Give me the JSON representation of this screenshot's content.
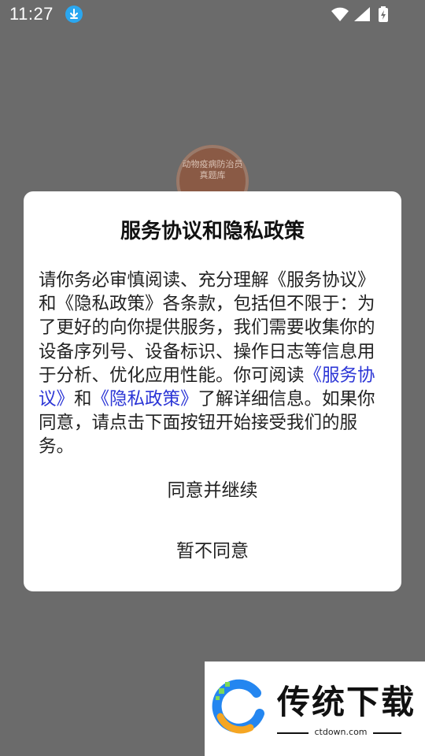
{
  "status_bar": {
    "time": "11:27",
    "icons": [
      "download-icon",
      "wifi-icon",
      "signal-icon",
      "battery-charging-icon"
    ]
  },
  "app": {
    "icon_label_line1": "动物疫病防治员",
    "icon_label_line2": "真题库"
  },
  "dialog": {
    "title": "服务协议和隐私政策",
    "body_part1": "请你务必审慎阅读、充分理解《服务协议》和《隐私政策》各条款，包括但不限于：为了更好的向你提供服务，我们需要收集你的设备序列号、设备标识、操作日志等信息用于分析、优化应用性能。你可阅读",
    "link_service": "《服务协议》",
    "body_and": "和",
    "link_privacy": "《隐私政策》",
    "body_part2": "了解详细信息。如果你同意，请点击下面按钮开始接受我们的服务。",
    "agree_button": "同意并继续",
    "decline_button": "暂不同意"
  },
  "watermark": {
    "title": "传统下载",
    "domain": "ctdown.com"
  },
  "colors": {
    "overlay": "#6b6b6b",
    "link": "#2b35d6",
    "download_badge": "#2aa7f0"
  }
}
